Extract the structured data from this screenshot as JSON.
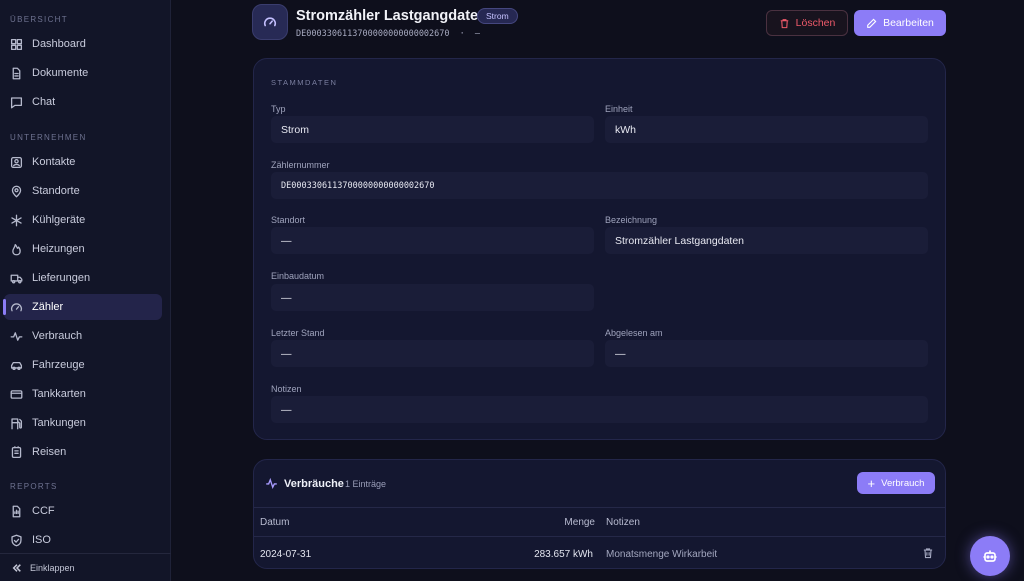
{
  "sidebar": {
    "sections": [
      "ÜBERSICHT",
      "UNTERNEHMEN",
      "REPORTS"
    ],
    "items": [
      {
        "label": "Dashboard",
        "icon": "dashboard-icon"
      },
      {
        "label": "Dokumente",
        "icon": "document-icon"
      },
      {
        "label": "Chat",
        "icon": "chat-icon"
      },
      {
        "label": "Kontakte",
        "icon": "contact-icon"
      },
      {
        "label": "Standorte",
        "icon": "location-pin-icon"
      },
      {
        "label": "Kühlgeräte",
        "icon": "snowflake-icon"
      },
      {
        "label": "Heizungen",
        "icon": "flame-icon"
      },
      {
        "label": "Lieferungen",
        "icon": "truck-icon"
      },
      {
        "label": "Zähler",
        "icon": "gauge-icon",
        "active": true
      },
      {
        "label": "Verbrauch",
        "icon": "activity-icon"
      },
      {
        "label": "Fahrzeuge",
        "icon": "car-icon"
      },
      {
        "label": "Tankkarten",
        "icon": "credit-card-icon"
      },
      {
        "label": "Tankungen",
        "icon": "fuel-icon"
      },
      {
        "label": "Reisen",
        "icon": "travel-icon"
      },
      {
        "label": "CCF",
        "icon": "report-icon"
      },
      {
        "label": "ISO",
        "icon": "shield-icon"
      }
    ],
    "collapse_label": "Einklappen"
  },
  "header": {
    "title": "Stromzähler Lastgangdaten",
    "badge": "Strom",
    "meter_id": "DE0003306113700000000000002670",
    "separator": "·",
    "location": "—",
    "delete_label": "Löschen",
    "edit_label": "Bearbeiten"
  },
  "stammdaten": {
    "section_label": "STAMMDATEN",
    "typ_label": "Typ",
    "typ_value": "Strom",
    "einheit_label": "Einheit",
    "einheit_value": "kWh",
    "zaehlernummer_label": "Zählernummer",
    "zaehlernummer_value": "DE0003306113700000000000002670",
    "standort_label": "Standort",
    "standort_value": "—",
    "bezeichnung_label": "Bezeichnung",
    "bezeichnung_value": "Stromzähler Lastgangdaten",
    "einbaudatum_label": "Einbaudatum",
    "einbaudatum_value": "—",
    "letzter_stand_label": "Letzter Stand",
    "letzter_stand_value": "—",
    "abgelesen_label": "Abgelesen am",
    "abgelesen_value": "—",
    "notizen_label": "Notizen",
    "notizen_value": "—"
  },
  "verbraeuche": {
    "title": "Verbräuche",
    "count": "1 Einträge",
    "add_label": "Verbrauch",
    "columns": [
      "Datum",
      "Menge",
      "Notizen"
    ],
    "rows": [
      {
        "datum": "2024-07-31",
        "menge": "283.657 kWh",
        "notizen": "Monatsmenge Wirkarbeit"
      }
    ]
  },
  "colors": {
    "accent": "#8c7cf7",
    "danger": "#ef5a6a",
    "background": "#0e0f1c"
  }
}
